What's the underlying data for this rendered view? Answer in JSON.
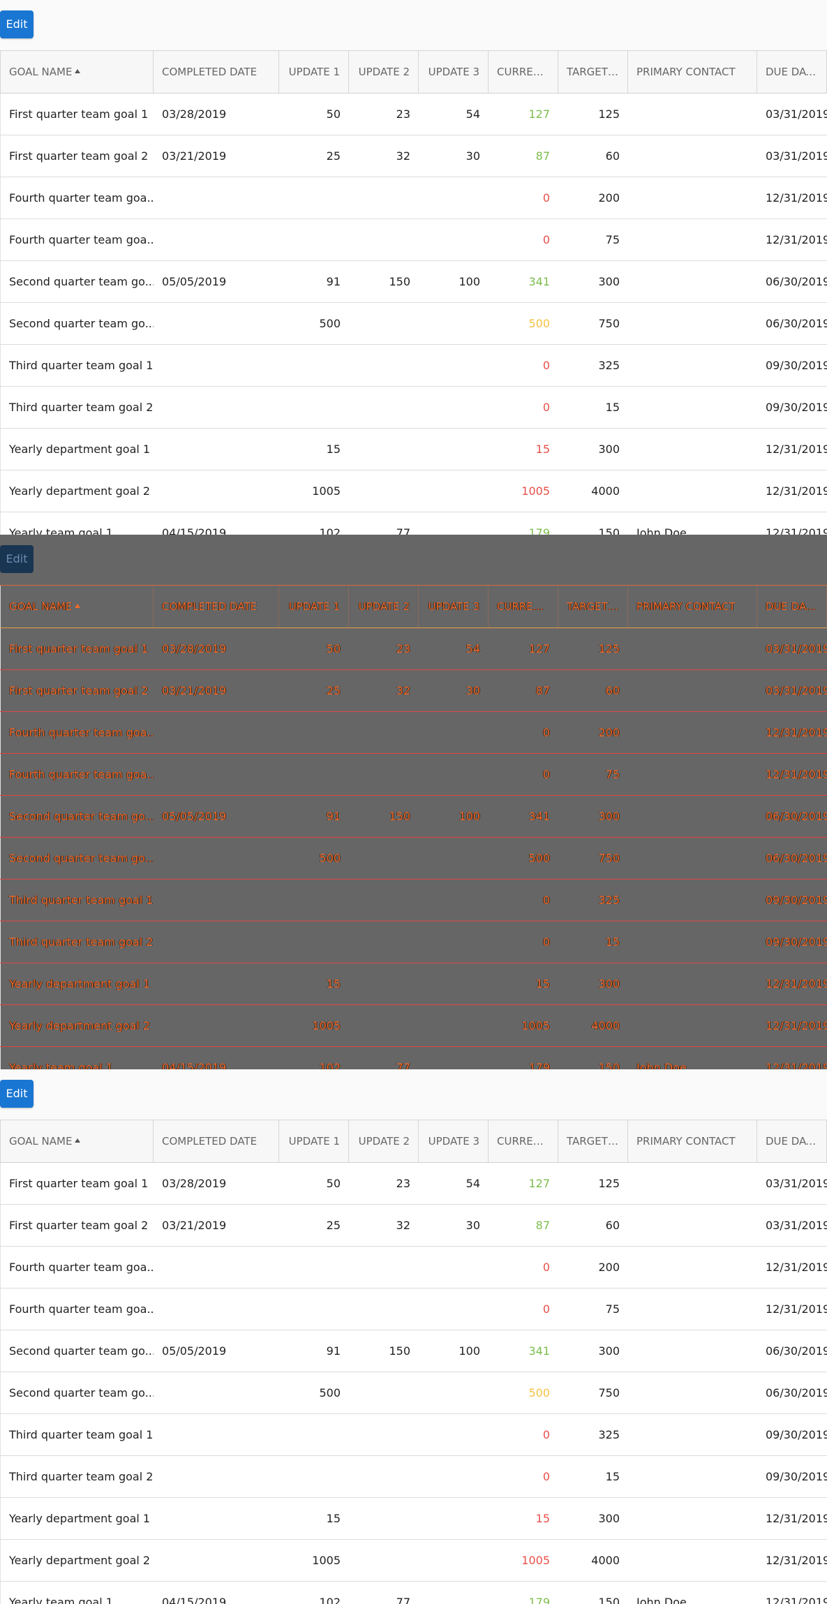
{
  "toolbar": {
    "edit_label": "Edit"
  },
  "grid": {
    "columns": [
      "GOAL NAME",
      "COMPLETED DATE",
      "UPDATE 1",
      "UPDATE 2",
      "UPDATE 3",
      "CURREN...",
      "TARGET ...",
      "PRIMARY CONTACT",
      "DUE DATE"
    ],
    "sort": {
      "column": "GOAL NAME",
      "direction": "ascending",
      "icon": "sort-ascending-icon"
    },
    "status_colors": {
      "green": "#7cbd4c",
      "red": "#e8504a",
      "yellow": "#f5c242"
    },
    "rows": [
      {
        "name": "First quarter team goal 1",
        "completed": "03/28/2019",
        "u1": "50",
        "u2": "23",
        "u3": "54",
        "current": "127",
        "status": "green",
        "target": "125",
        "contact": "",
        "due": "03/31/2019"
      },
      {
        "name": "First quarter team goal 2",
        "completed": "03/21/2019",
        "u1": "25",
        "u2": "32",
        "u3": "30",
        "current": "87",
        "status": "green",
        "target": "60",
        "contact": "",
        "due": "03/31/2019"
      },
      {
        "name": "Fourth quarter team goa...",
        "completed": "",
        "u1": "",
        "u2": "",
        "u3": "",
        "current": "0",
        "status": "red",
        "target": "200",
        "contact": "",
        "due": "12/31/2019"
      },
      {
        "name": "Fourth quarter team goa...",
        "completed": "",
        "u1": "",
        "u2": "",
        "u3": "",
        "current": "0",
        "status": "red",
        "target": "75",
        "contact": "",
        "due": "12/31/2019"
      },
      {
        "name": "Second quarter team go...",
        "completed": "05/05/2019",
        "u1": "91",
        "u2": "150",
        "u3": "100",
        "current": "341",
        "status": "green",
        "target": "300",
        "contact": "",
        "due": "06/30/2019"
      },
      {
        "name": "Second quarter team go...",
        "completed": "",
        "u1": "500",
        "u2": "",
        "u3": "",
        "current": "500",
        "status": "yellow",
        "target": "750",
        "contact": "",
        "due": "06/30/2019"
      },
      {
        "name": "Third quarter team goal 1",
        "completed": "",
        "u1": "",
        "u2": "",
        "u3": "",
        "current": "0",
        "status": "red",
        "target": "325",
        "contact": "",
        "due": "09/30/2019"
      },
      {
        "name": "Third quarter team goal 2",
        "completed": "",
        "u1": "",
        "u2": "",
        "u3": "",
        "current": "0",
        "status": "red",
        "target": "15",
        "contact": "",
        "due": "09/30/2019"
      },
      {
        "name": "Yearly department goal 1",
        "completed": "",
        "u1": "15",
        "u2": "",
        "u3": "",
        "current": "15",
        "status": "red",
        "target": "300",
        "contact": "",
        "due": "12/31/2019"
      },
      {
        "name": "Yearly department goal 2",
        "completed": "",
        "u1": "1005",
        "u2": "",
        "u3": "",
        "current": "1005",
        "status": "red",
        "target": "4000",
        "contact": "",
        "due": "12/31/2019"
      },
      {
        "name": "Yearly team goal 1",
        "completed": "04/15/2019",
        "u1": "102",
        "u2": "77",
        "u3": "",
        "current": "179",
        "status": "green",
        "target": "150",
        "contact": "John Doe",
        "due": "12/31/2019"
      }
    ]
  }
}
